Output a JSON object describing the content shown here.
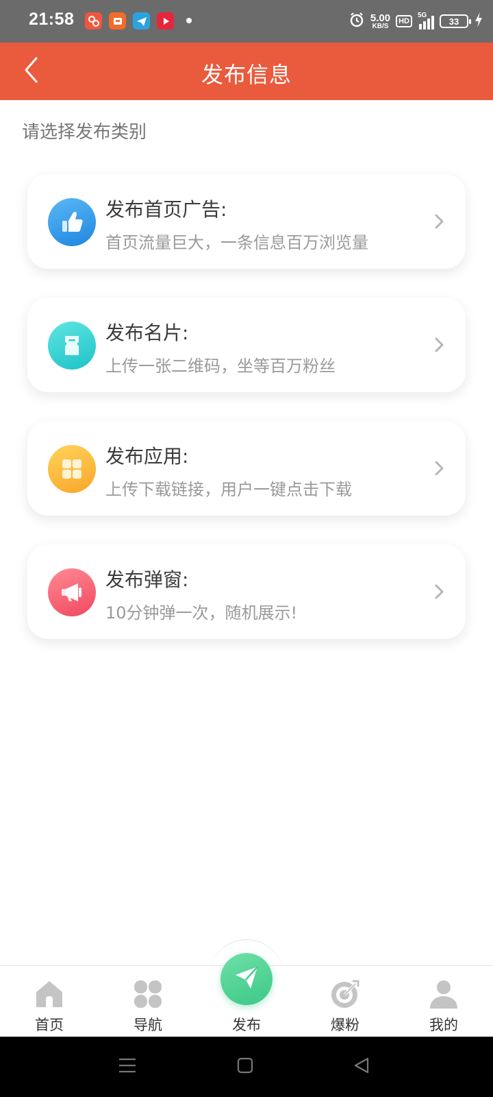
{
  "status_bar": {
    "time": "21:58",
    "net_speed_value": "5.00",
    "net_speed_unit": "KB/S",
    "hd_label": "HD",
    "signal_label": "5G",
    "battery_level": "33"
  },
  "header": {
    "title": "发布信息"
  },
  "section_label": "请选择发布类别",
  "cards": [
    {
      "title": "发布首页广告:",
      "desc": "首页流量巨大，一条信息百万浏览量",
      "icon": "thumbs-up-icon",
      "color": "#2b95e9"
    },
    {
      "title": "发布名片:",
      "desc": "上传一张二维码，坐等百万粉丝",
      "icon": "card-icon",
      "color": "#27d0d0"
    },
    {
      "title": "发布应用:",
      "desc": "上传下载链接，用户一键点击下载",
      "icon": "apps-grid-icon",
      "color": "#fbb53a"
    },
    {
      "title": "发布弹窗:",
      "desc": "10分钟弹一次，随机展示!",
      "icon": "megaphone-icon",
      "color": "#f45a6e"
    }
  ],
  "bottom_nav": [
    {
      "label": "首页",
      "icon": "home-icon"
    },
    {
      "label": "导航",
      "icon": "clover-icon"
    },
    {
      "label": "发布",
      "icon": "paper-plane-icon"
    },
    {
      "label": "爆粉",
      "icon": "target-icon"
    },
    {
      "label": "我的",
      "icon": "user-icon"
    }
  ],
  "colors": {
    "header_bg": "#ea5a3c",
    "publish_green": "#3cc888"
  }
}
